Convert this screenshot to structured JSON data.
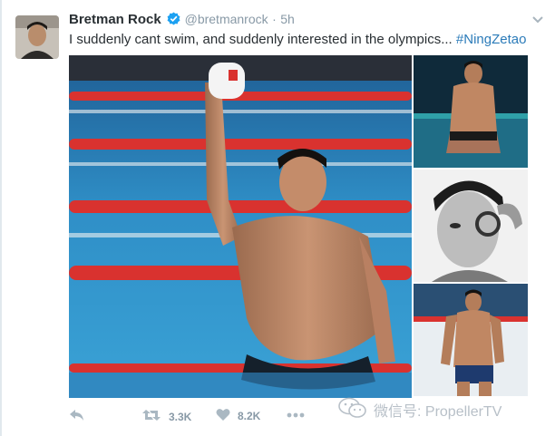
{
  "tweet": {
    "author_name": "Bretman Rock",
    "handle": "@bretmanrock",
    "separator": "·",
    "time": "5h",
    "text": "I suddenly cant swim, and suddenly interested in the olympics...",
    "hashtag": "#NingZetao"
  },
  "actions": {
    "retweet_count": "3.3K",
    "like_count": "8.2K"
  },
  "watermark": {
    "text": "微信号: PropellerTV"
  },
  "icons": {
    "verified": "verified-badge-icon",
    "reply": "reply-icon",
    "retweet": "retweet-icon",
    "like": "heart-icon",
    "more": "more-icon",
    "caret": "chevron-down-icon",
    "wechat": "wechat-logo-icon"
  },
  "colors": {
    "link": "#2b7bb9",
    "verified": "#1da1f2",
    "muted": "#8899a6",
    "text": "#292f33",
    "pool_water": "#2f8fc7",
    "lane_rope": "#d9322f"
  }
}
